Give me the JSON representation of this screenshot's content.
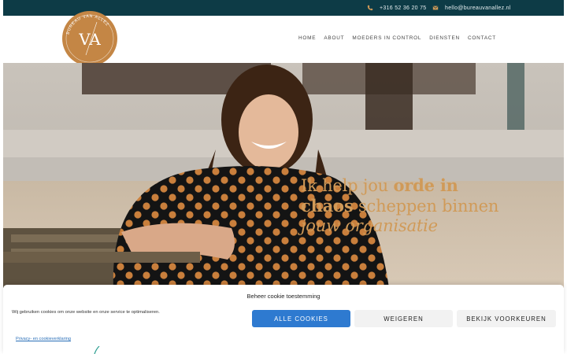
{
  "topbar": {
    "phone": "+316 52 36 20 75",
    "email": "hello@bureauvanallez.nl",
    "phone_icon": "phone-icon",
    "email_icon": "envelope-icon"
  },
  "logo": {
    "initials": "VA",
    "ring_text": "BUREAU VAN ALLEZ"
  },
  "nav": {
    "items": [
      "HOME",
      "ABOUT",
      "MOEDERS IN CONTROL",
      "DIENSTEN",
      "CONTACT"
    ]
  },
  "hero": {
    "line1_regular": "Ik help jou ",
    "line1_bold": "orde in",
    "line2_bold": "chaos",
    "line2_regular": " scheppen binnen",
    "line3_italic": "jouw organisatie"
  },
  "cookie": {
    "title": "Beheer cookie toestemming",
    "text": "Wij gebruiken cookies om onze website en onze service te optimaliseren.",
    "accept_label": "ALLE COOKIES",
    "deny_label": "WEIGEREN",
    "prefs_label": "BEKIJK VOORKEUREN",
    "policy_link": "Privacy- en cookieverklaring"
  },
  "colors": {
    "topbar": "#0d3b46",
    "brand_copper": "#c48645",
    "headline": "#d09a58",
    "accept_button": "#2e7ad0"
  }
}
